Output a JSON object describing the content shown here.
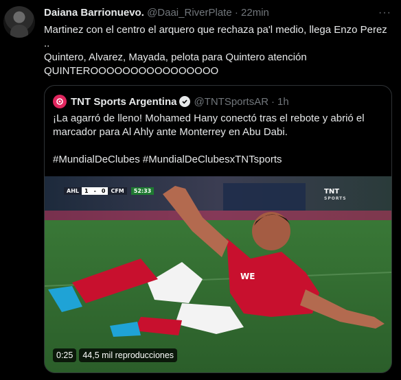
{
  "tweet": {
    "author_name": "Daiana Barrionuevo.",
    "author_handle": "@Daai_RiverPlate",
    "separator": "·",
    "time": "22min",
    "more_label": "···",
    "lines": [
      "Martinez con el centro el arquero que rechaza pa'l medio, llega Enzo Perez",
      "..",
      "Quintero, Alvarez, Mayada, pelota para Quintero atención",
      "QUINTEROOOOOOOOOOOOOOOO"
    ]
  },
  "quoted": {
    "author_name": "TNT Sports Argentina",
    "author_handle": "@TNTSportsAR",
    "separator": "·",
    "time": "1h",
    "paragraph1": "¡La agarró de lleno! Mohamed Hany conectó tras el rebote y abrió el marcador para Al Ahly ante Monterrey en Abu Dabi.",
    "paragraph2": "#MundialDeClubes #MundialDeClubesxTNTsports"
  },
  "video": {
    "scorebug": {
      "team_home": "AHL",
      "score_home": "1",
      "score_sep": "-",
      "score_away": "0",
      "team_away": "CFM",
      "clock": "52:33"
    },
    "broadcaster": "TNT",
    "broadcaster_sub": "SPORTS",
    "duration": "0:25",
    "views": "44,5 mil reproducciones"
  },
  "colors": {
    "background": "#000000",
    "text": "#e7e9ea",
    "muted": "#71767b",
    "border": "#2f3336",
    "tnt_brand": "#e0265e",
    "jersey_red": "#c8102e",
    "pitch": "#2f6b2f"
  },
  "icons": [
    "avatar",
    "more-icon",
    "tnt-logo-icon",
    "verified-badge-icon"
  ]
}
